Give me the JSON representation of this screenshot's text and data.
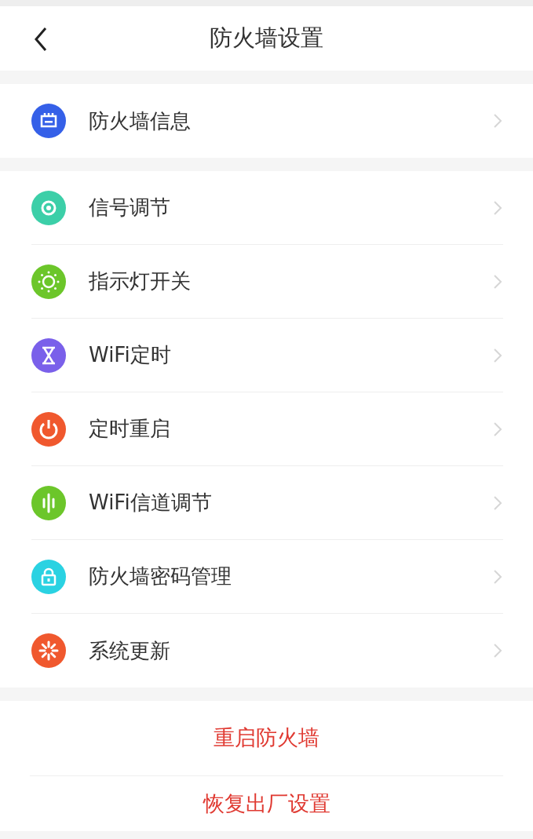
{
  "header": {
    "title": "防火墙设置"
  },
  "groups": [
    {
      "items": [
        {
          "label": "防火墙信息",
          "color": "#3560e8"
        }
      ]
    },
    {
      "items": [
        {
          "label": "信号调节",
          "color": "#3ccfa8"
        },
        {
          "label": "指示灯开关",
          "color": "#6cc62a"
        },
        {
          "label": "WiFi定时",
          "color": "#7a60ea"
        },
        {
          "label": "定时重启",
          "color": "#f0582e"
        },
        {
          "label": "WiFi信道调节",
          "color": "#6cc62a"
        },
        {
          "label": "防火墙密码管理",
          "color": "#2ad2e2"
        },
        {
          "label": "系统更新",
          "color": "#f0582e"
        }
      ]
    }
  ],
  "actions": [
    "重启防火墙",
    "恢复出厂设置"
  ]
}
